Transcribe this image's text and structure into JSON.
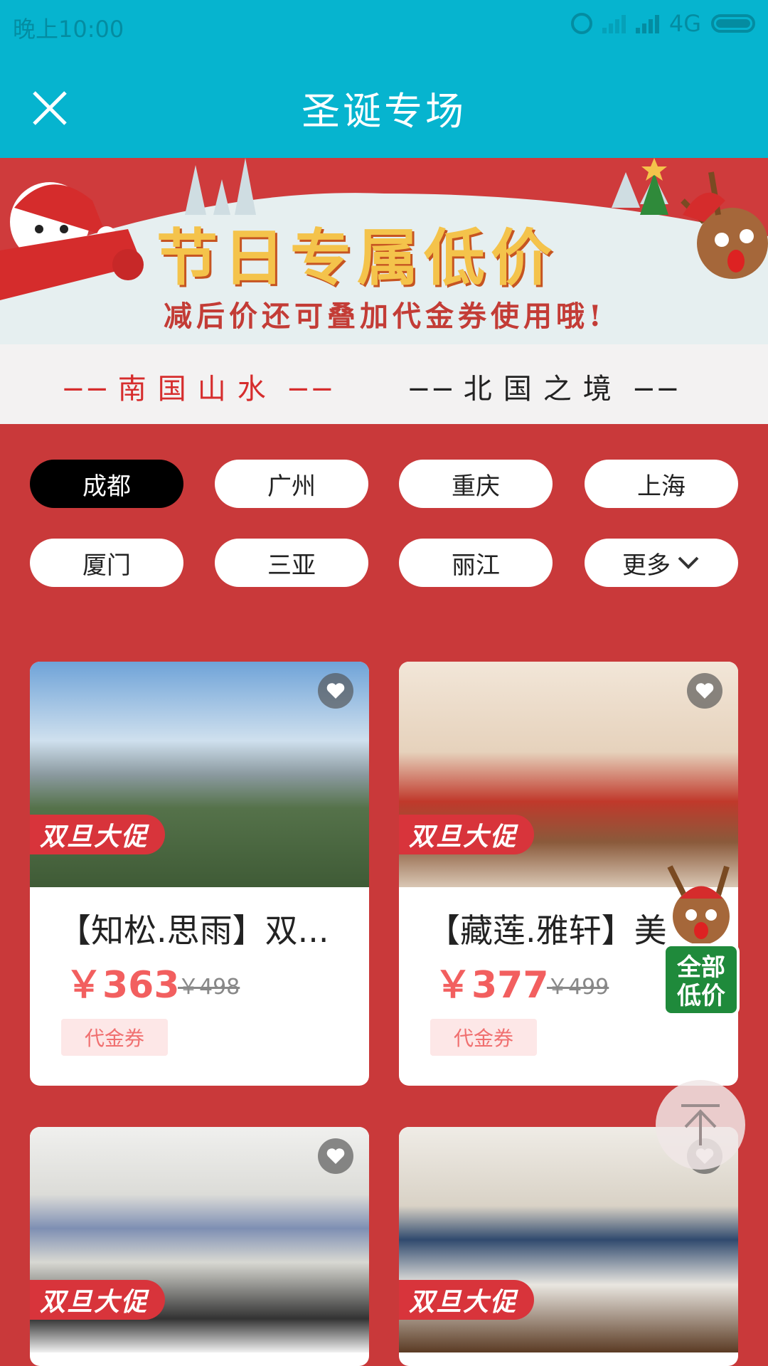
{
  "status_bar": {
    "time": "晚上10:00",
    "network": "4G"
  },
  "header": {
    "title": "圣诞专场"
  },
  "banner": {
    "title": "节日专属低价",
    "subtitle": "减后价还可叠加代金券使用哦!"
  },
  "region_tabs": [
    {
      "label": "南国山水",
      "active": true
    },
    {
      "label": "北国之境",
      "active": false
    }
  ],
  "cities": [
    {
      "label": "成都",
      "active": true
    },
    {
      "label": "广州"
    },
    {
      "label": "重庆"
    },
    {
      "label": "上海"
    },
    {
      "label": "厦门"
    },
    {
      "label": "三亚"
    },
    {
      "label": "丽江"
    },
    {
      "label": "更多"
    }
  ],
  "listings": [
    {
      "badge": "双旦大促",
      "name": "【知松.思雨】双...",
      "price": "￥363",
      "original_price": "￥498",
      "voucher": "代金券"
    },
    {
      "badge": "双旦大促",
      "name": "【藏莲.雅轩】美",
      "price": "￥377",
      "original_price": "￥499",
      "voucher": "代金券"
    },
    {
      "badge": "双旦大促"
    },
    {
      "badge": "双旦大促"
    }
  ],
  "floating": {
    "deer_label_line1": "全部",
    "deer_label_line2": "低价"
  },
  "colors": {
    "header_bg": "#06b4cf",
    "page_bg": "#c9393a",
    "price": "#f25f5f",
    "active_tab": "#d62d2d"
  }
}
